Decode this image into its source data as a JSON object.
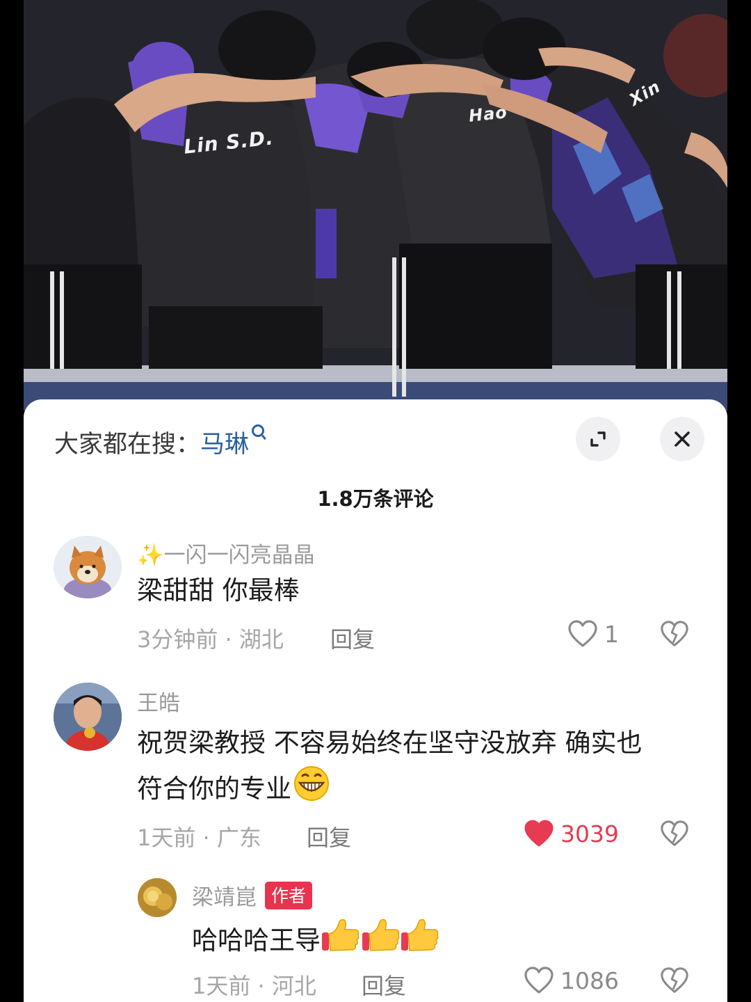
{
  "photo": {
    "jersey_name": "Lin S.D.",
    "jersey_name_2": "Hao",
    "jersey_name_3": "Xin"
  },
  "search_bar": {
    "prefix": "大家都在搜：",
    "term": "马琳"
  },
  "comments_panel": {
    "count_title": "1.8万条评论"
  },
  "comments": [
    {
      "username_emoji": "✨",
      "username": "一闪一闪亮晶晶",
      "text": "梁甜甜 你最棒",
      "time": "3分钟前 · 湖北",
      "reply_label": "回复",
      "likes": "1",
      "liked": false
    },
    {
      "username": "王皓",
      "text_line1": "祝贺梁教授 不容易始终在坚守没放弃 确实也",
      "text_line2": "符合你的专业",
      "time": "1天前 · 广东",
      "reply_label": "回复",
      "likes": "3039",
      "liked": true
    },
    {
      "username": "梁靖崑",
      "badge": "作者",
      "text": "哈哈哈王导",
      "time": "1天前 · 河北",
      "reply_label": "回复",
      "likes": "1086",
      "liked": false
    }
  ],
  "colors": {
    "accent_blue": "#2b5f9e",
    "like_red": "#e63b52",
    "badge_red": "#e8344e"
  }
}
